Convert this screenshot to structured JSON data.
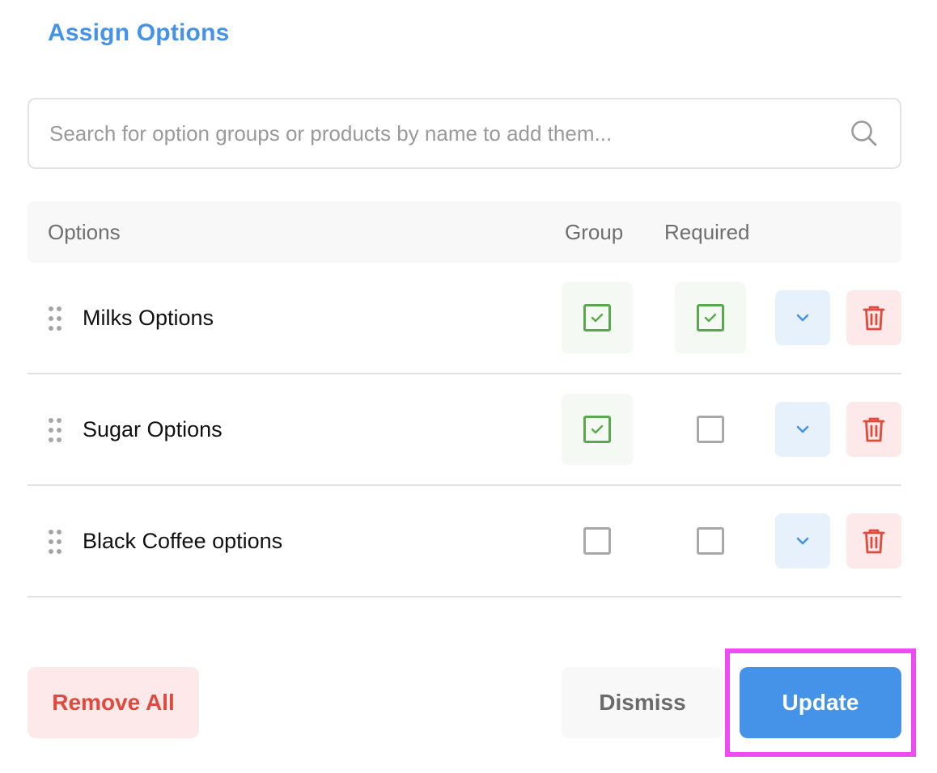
{
  "title": "Assign Options",
  "search": {
    "placeholder": "Search for option groups or products by name to add them...",
    "value": "",
    "icon": "search-icon"
  },
  "table": {
    "headers": {
      "options": "Options",
      "group": "Group",
      "required": "Required"
    },
    "rows": [
      {
        "label": "Milks Options",
        "group": true,
        "required": true
      },
      {
        "label": "Sugar Options",
        "group": true,
        "required": false
      },
      {
        "label": "Black Coffee options",
        "group": false,
        "required": false
      }
    ]
  },
  "footer": {
    "remove_all": "Remove All",
    "dismiss": "Dismiss",
    "update": "Update"
  },
  "colors": {
    "accent": "#4493e8",
    "danger": "#de4a3c",
    "check": "#5aa84c",
    "highlight": "#ee4cf0"
  }
}
